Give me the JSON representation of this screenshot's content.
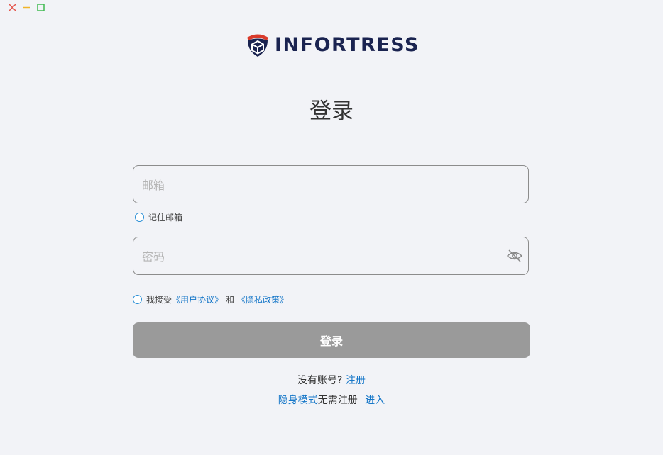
{
  "window_controls": {
    "close_color": "#e5544b",
    "minimize_color": "#f0b429",
    "maximize_color": "#3fb950"
  },
  "brand": {
    "name": "INFORTRESS",
    "primary_color": "#1a2350",
    "accent_color": "#d93a2b"
  },
  "title": "登录",
  "email": {
    "placeholder": "邮箱",
    "value": ""
  },
  "remember_email": {
    "label": "记住邮箱",
    "checked": false
  },
  "password": {
    "placeholder": "密码",
    "value": "",
    "toggle_icon": "eye-icon"
  },
  "agreement": {
    "prefix": "我接受",
    "user_agreement": "《用户协议》",
    "conjunction": "和",
    "privacy_policy": "《隐私政策》",
    "checked": false
  },
  "login_button": "登录",
  "register": {
    "prompt": "没有账号?",
    "link": "注册"
  },
  "incognito": {
    "mode_link": "隐身模式",
    "text": "无需注册",
    "enter_link": "进入"
  },
  "colors": {
    "link": "#1677c8",
    "button_disabled": "#9a9a9a",
    "radio_border": "#2a8fd6",
    "background": "#f2f3f7"
  }
}
